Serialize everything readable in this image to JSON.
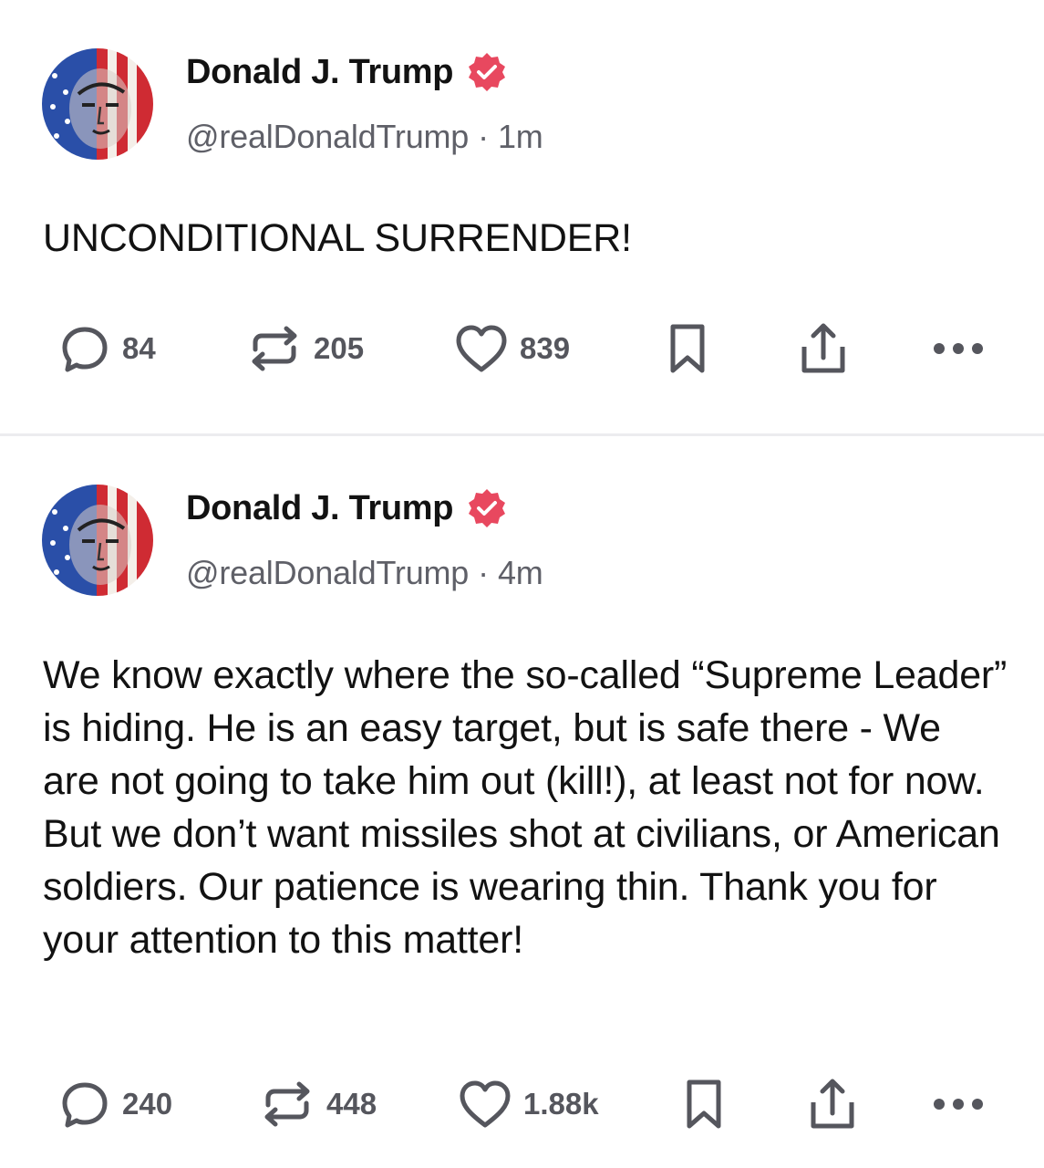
{
  "posts": [
    {
      "author_name": "Donald J. Trump",
      "handle": "@realDonaldTrump",
      "separator": "·",
      "time": "1m",
      "text": "UNCONDITIONAL SURRENDER!",
      "replies": "84",
      "reposts": "205",
      "likes": "839"
    },
    {
      "author_name": "Donald J. Trump",
      "handle": "@realDonaldTrump",
      "separator": "·",
      "time": "4m",
      "text": "We know exactly where the so-called “Supreme Leader” is hiding. He is an easy target, but is safe there - We are not going to take him out (kill!), at least not for now. But we don’t want missiles shot at civilians, or American soldiers. Our patience is wearing thin. Thank you for your attention to this matter!",
      "replies": "240",
      "reposts": "448",
      "likes": "1.88k"
    }
  ],
  "icons": {
    "reply": "reply-bubble-icon",
    "repost": "repost-arrows-icon",
    "like": "heart-icon",
    "bookmark": "bookmark-icon",
    "share": "share-upload-icon",
    "more": "more-dots-icon",
    "verified": "verified-badge-icon"
  },
  "colors": {
    "verified_badge": "#e8485f",
    "icon_gray": "#55565d",
    "handle_gray": "#5f6068"
  }
}
